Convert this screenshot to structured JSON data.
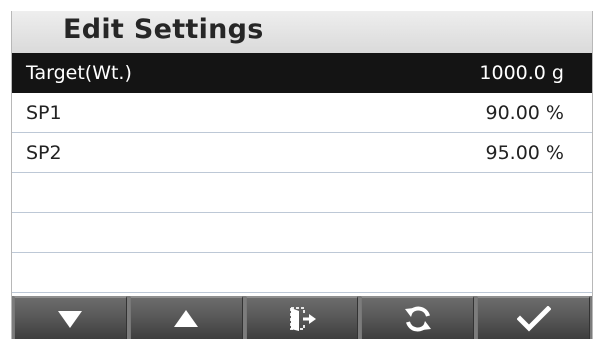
{
  "header": {
    "title": "Edit Settings"
  },
  "rows": [
    {
      "label": "Target(Wt.)",
      "value": "1000.0 g",
      "selected": true
    },
    {
      "label": "SP1",
      "value": "90.00 %",
      "selected": false
    },
    {
      "label": "SP2",
      "value": "95.00 %",
      "selected": false
    },
    {
      "label": "",
      "value": "",
      "selected": false
    },
    {
      "label": "",
      "value": "",
      "selected": false
    },
    {
      "label": "",
      "value": "",
      "selected": false
    }
  ],
  "toolbar": {
    "buttons": [
      {
        "icon": "arrow-down-icon"
      },
      {
        "icon": "arrow-up-icon"
      },
      {
        "icon": "exit-icon"
      },
      {
        "icon": "refresh-icon"
      },
      {
        "icon": "checkmark-icon"
      }
    ]
  },
  "colors": {
    "selected_row_bg": "#141414",
    "row_divider": "#bdc8d6",
    "toolbar_bg": "#595959"
  }
}
